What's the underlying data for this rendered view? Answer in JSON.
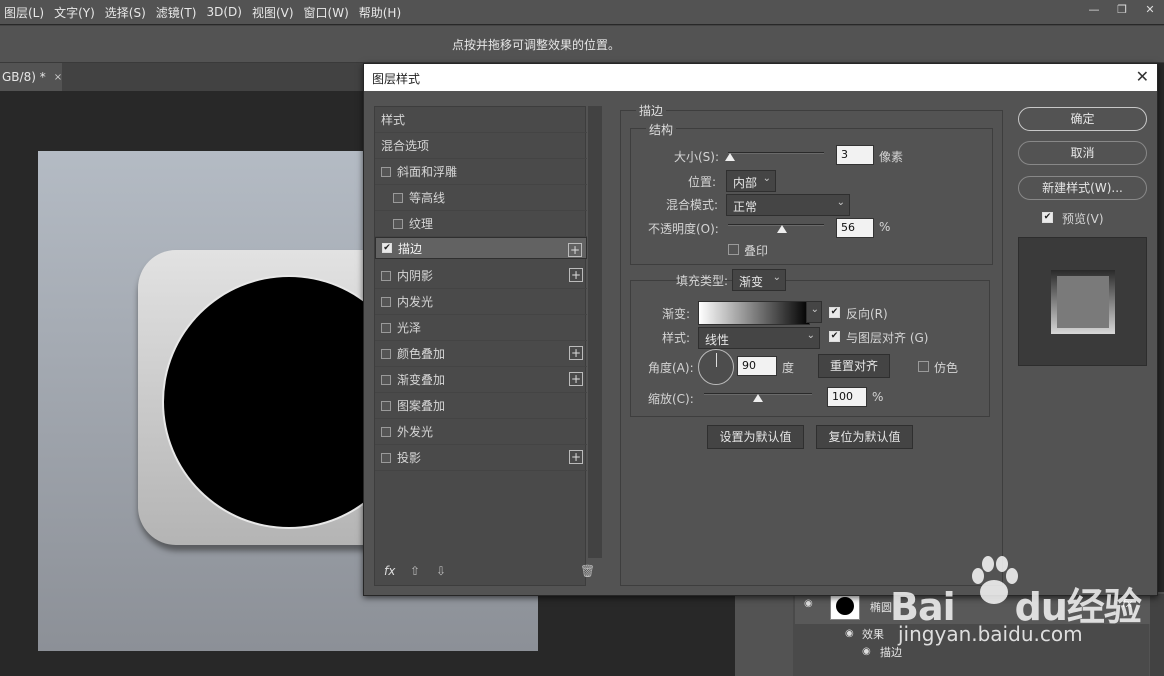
{
  "menu": [
    "图层(L)",
    "文字(Y)",
    "选择(S)",
    "滤镜(T)",
    "3D(D)",
    "视图(V)",
    "窗口(W)",
    "帮助(H)"
  ],
  "window_controls": {
    "minimize": "—",
    "restore": "❐",
    "close": "✕"
  },
  "options_hint": "点按并拖移可调整效果的位置。",
  "doc_tab": {
    "label": "GB/8) *",
    "close": "×"
  },
  "dialog": {
    "title": "图层样式",
    "close": "✕",
    "styles_list": [
      {
        "label": "样式",
        "checkbox": false
      },
      {
        "label": "混合选项",
        "checkbox": false
      },
      {
        "label": "斜面和浮雕",
        "checkbox": true,
        "checked": false,
        "indent": 0
      },
      {
        "label": "等高线",
        "checkbox": true,
        "checked": false,
        "indent": 1
      },
      {
        "label": "纹理",
        "checkbox": true,
        "checked": false,
        "indent": 1
      },
      {
        "label": "描边",
        "checkbox": true,
        "checked": true,
        "plus": true,
        "selected": true
      },
      {
        "label": "内阴影",
        "checkbox": true,
        "checked": false,
        "plus": true
      },
      {
        "label": "内发光",
        "checkbox": true,
        "checked": false
      },
      {
        "label": "光泽",
        "checkbox": true,
        "checked": false
      },
      {
        "label": "颜色叠加",
        "checkbox": true,
        "checked": false,
        "plus": true
      },
      {
        "label": "渐变叠加",
        "checkbox": true,
        "checked": false,
        "plus": true
      },
      {
        "label": "图案叠加",
        "checkbox": true,
        "checked": false
      },
      {
        "label": "外发光",
        "checkbox": true,
        "checked": false
      },
      {
        "label": "投影",
        "checkbox": true,
        "checked": false,
        "plus": true
      }
    ],
    "footer_icons": {
      "fx": "fx",
      "up": "⇧",
      "down": "⇩",
      "trash": "🗑"
    },
    "stroke": {
      "section": "描边",
      "structure": "结构",
      "size_label": "大小(S):",
      "size_value": "3",
      "size_unit": "像素",
      "size_level": 0.02,
      "position_label": "位置:",
      "position_value": "内部",
      "blend_label": "混合模式:",
      "blend_value": "正常",
      "opacity_label": "不透明度(O):",
      "opacity_value": "56",
      "opacity_unit": "%",
      "opacity_level": 0.56,
      "overprint_label": "叠印",
      "fill_type_label": "填充类型:",
      "fill_type_value": "渐变",
      "gradient_label": "渐变:",
      "reverse_label": "反向(R)",
      "style_label": "样式:",
      "style_value": "线性",
      "align_label": "与图层对齐 (G)",
      "angle_label": "角度(A):",
      "angle_value": "90",
      "angle_unit": "度",
      "reset_align": "重置对齐",
      "dither_label": "仿色",
      "scale_label": "缩放(C):",
      "scale_value": "100",
      "scale_unit": "%",
      "scale_level": 0.5,
      "set_default": "设置为默认值",
      "reset_default": "复位为默认值"
    },
    "buttons": {
      "ok": "确定",
      "cancel": "取消",
      "new_style": "新建样式(W)...",
      "preview": "预览(V)"
    }
  },
  "layers": {
    "layer_name": "椭圆",
    "fx": "fx",
    "effects_label": "效果",
    "stroke_effect": "描边"
  },
  "watermark": {
    "brand_a": "Bai",
    "brand_b": "du",
    "brand_c": "经验",
    "url": "jingyan.baidu.com"
  }
}
